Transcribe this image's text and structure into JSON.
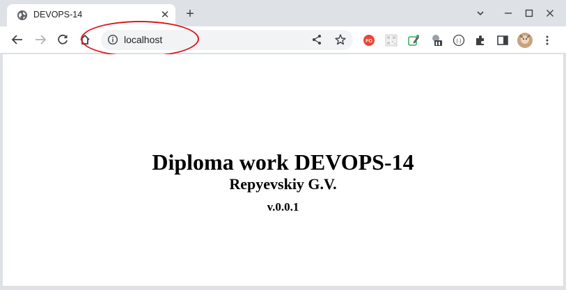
{
  "browser": {
    "tab": {
      "title": "DEVOPS-14",
      "favicon": "globe-icon",
      "close_glyph": "✕"
    },
    "new_tab_glyph": "+",
    "window_controls": {
      "tab_search_glyph": "⌄",
      "minimize_glyph": "—",
      "maximize_glyph": "☐",
      "close_glyph": "✕"
    },
    "address_bar": {
      "url": "localhost",
      "site_info_icon": "info-icon"
    },
    "extensions": [
      {
        "name": "fo-extension-icon",
        "label": "FO",
        "color": "#ea4335"
      },
      {
        "name": "qr-extension-icon",
        "label": ""
      },
      {
        "name": "edit-extension-icon",
        "label": ""
      },
      {
        "name": "translate-extension-icon",
        "label": ""
      },
      {
        "name": "code-extension-icon",
        "label": "(·)"
      },
      {
        "name": "puzzle-extensions-icon",
        "label": ""
      },
      {
        "name": "side-panel-icon",
        "label": ""
      },
      {
        "name": "profile-avatar",
        "label": ""
      },
      {
        "name": "menu-kebab-icon",
        "label": "⋮"
      }
    ],
    "annotation_color": "#e0161c"
  },
  "page": {
    "heading": "Diploma work DEVOPS-14",
    "author": "Repyevskiy G.V.",
    "version": "v.0.0.1"
  }
}
